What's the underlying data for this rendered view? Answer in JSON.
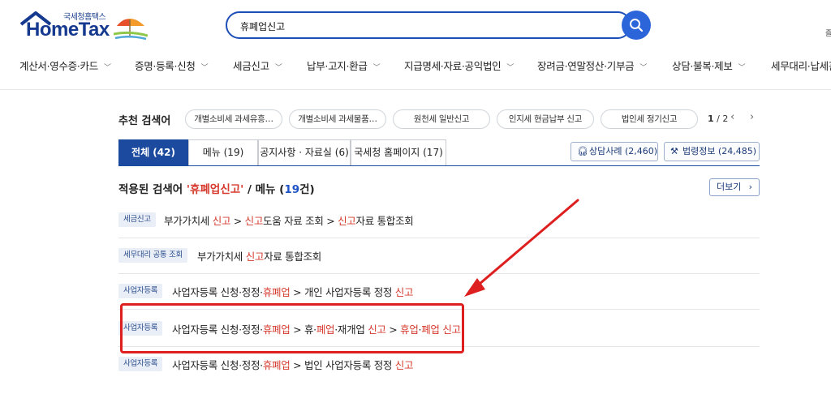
{
  "header": {
    "logo_small": "국세청홈택스",
    "logo_big": "HomeTax",
    "search_value": "휴폐업신고",
    "edge_char": "즐"
  },
  "nav": [
    {
      "label": "계산서·영수증·카드"
    },
    {
      "label": "증명·등록·신청"
    },
    {
      "label": "세금신고"
    },
    {
      "label": "납부·고지·환급"
    },
    {
      "label": "지급명세·자료·공익법인"
    },
    {
      "label": "장려금·연말정산·기부금"
    },
    {
      "label": "상담·불복·제보"
    },
    {
      "label": "세무대리·납세관"
    }
  ],
  "recommend": {
    "label": "추천 검색어",
    "chips": [
      "개별소비세 과세유흥…",
      "개별소비세 과세물품…",
      "원천세 일반신고",
      "인지세 현금납부 신고",
      "법인세 정기신고"
    ],
    "page_current": "1",
    "page_total": "/ 2"
  },
  "tabs": [
    {
      "label": "전체 (42)",
      "active": true
    },
    {
      "label": "메뉴 (19)",
      "active": false
    },
    {
      "label": "공지사항 · 자료실 (6)",
      "active": false
    },
    {
      "label": "국세청 홈페이지 (17)",
      "active": false
    }
  ],
  "side_buttons": [
    {
      "label": "상담사례 (2,460)",
      "icon": "headset-icon"
    },
    {
      "label": "법령정보 (24,485)",
      "icon": "gavel-icon"
    }
  ],
  "applied": {
    "prefix": "적용된 검색어 ",
    "keyword": "'휴폐업신고'",
    "middle": " / 메뉴 (",
    "count": "19",
    "suffix": "건)",
    "more_label": "더보기"
  },
  "results": [
    {
      "badge": "세금신고",
      "segments": [
        {
          "t": "부가가치세 ",
          "red": false
        },
        {
          "t": "신고",
          "red": true
        },
        {
          "t": " > ",
          "red": false
        },
        {
          "t": "신고",
          "red": true
        },
        {
          "t": "도움 자료 조회 > ",
          "red": false
        },
        {
          "t": "신고",
          "red": true
        },
        {
          "t": "자료 통합조회",
          "red": false
        }
      ]
    },
    {
      "badge": "세무대리 공통 조회",
      "segments": [
        {
          "t": "부가가치세 ",
          "red": false
        },
        {
          "t": "신고",
          "red": true
        },
        {
          "t": "자료 통합조회",
          "red": false
        }
      ]
    },
    {
      "badge": "사업자등록",
      "segments": [
        {
          "t": "사업자등록 신청·정정·",
          "red": false
        },
        {
          "t": "휴폐업",
          "red": true
        },
        {
          "t": " > 개인 사업자등록 정정 ",
          "red": false
        },
        {
          "t": "신고",
          "red": true
        }
      ]
    },
    {
      "badge": "사업자등록",
      "segments": [
        {
          "t": "사업자등록 신청·정정·",
          "red": false
        },
        {
          "t": "휴폐업",
          "red": true
        },
        {
          "t": " > 휴·",
          "red": false
        },
        {
          "t": "폐업",
          "red": true
        },
        {
          "t": "·재개업 ",
          "red": false
        },
        {
          "t": "신고",
          "red": true
        },
        {
          "t": " > ",
          "red": false
        },
        {
          "t": "휴업",
          "red": true
        },
        {
          "t": "·",
          "red": false
        },
        {
          "t": "폐업",
          "red": true
        },
        {
          "t": " ",
          "red": false
        },
        {
          "t": "신고",
          "red": true
        }
      ]
    },
    {
      "badge": "사업자등록",
      "segments": [
        {
          "t": "사업자등록 신청·정정·",
          "red": false
        },
        {
          "t": "휴폐업",
          "red": true
        },
        {
          "t": " > 법인 사업자등록 정정 ",
          "red": false
        },
        {
          "t": "신고",
          "red": true
        }
      ]
    }
  ],
  "colors": {
    "brand": "#14398f",
    "active_tab": "#1b4a9f",
    "highlight": "#d6392d",
    "annotation": "#dd1f1f"
  }
}
